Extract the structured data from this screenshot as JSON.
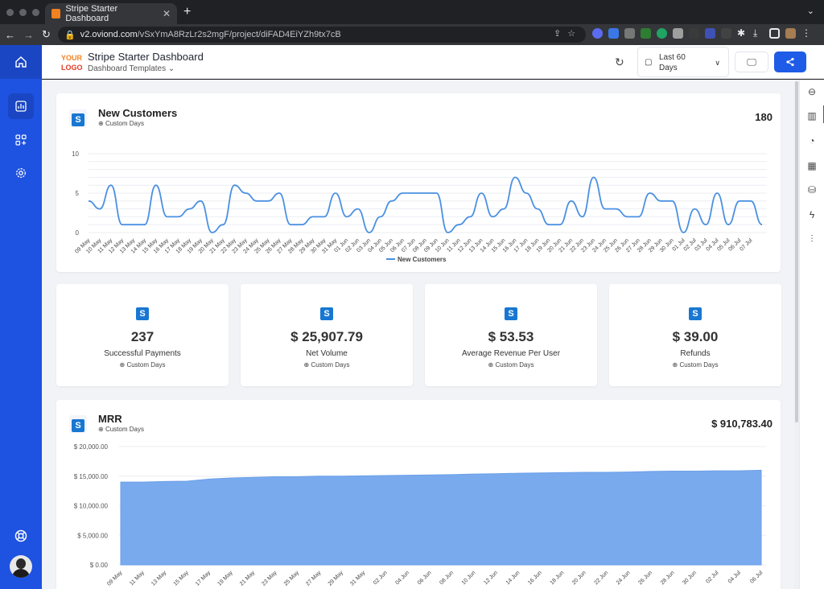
{
  "browser": {
    "tab_title": "Stripe Starter Dashboard",
    "url_host": "v2.oviond.com",
    "url_path": "/vSxYmA8RzLr2s2mgF/project/diFAD4EiYZh9tx7cB"
  },
  "header": {
    "logo_line1": "YOUR",
    "logo_line2": "LOGO",
    "title": "Stripe Starter Dashboard",
    "subtitle": "Dashboard Templates",
    "date_range": "Last 60 Days"
  },
  "colors": {
    "accent": "#1e5be6",
    "sidebar": "#1e52e0",
    "line": "#4a90e2",
    "area": "#79aaee"
  },
  "cards": {
    "new_customers": {
      "title": "New Customers",
      "sub": "Custom Days",
      "value": "180",
      "legend": "New Customers"
    },
    "mrr": {
      "title": "MRR",
      "sub": "Custom Days",
      "value": "$ 910,783.40"
    }
  },
  "stats": [
    {
      "value": "237",
      "label": "Successful Payments",
      "sub": "Custom Days"
    },
    {
      "value": "$ 25,907.79",
      "label": "Net Volume",
      "sub": "Custom Days"
    },
    {
      "value": "$ 53.53",
      "label": "Average Revenue Per User",
      "sub": "Custom Days"
    },
    {
      "value": "$ 39.00",
      "label": "Refunds",
      "sub": "Custom Days"
    }
  ],
  "chart_data": [
    {
      "type": "line",
      "title": "New Customers",
      "x": [
        "09 May",
        "10 May",
        "11 May",
        "12 May",
        "13 May",
        "14 May",
        "15 May",
        "16 May",
        "17 May",
        "18 May",
        "19 May",
        "20 May",
        "21 May",
        "22 May",
        "23 May",
        "24 May",
        "25 May",
        "26 May",
        "27 May",
        "28 May",
        "29 May",
        "30 May",
        "31 May",
        "01 Jun",
        "02 Jun",
        "03 Jun",
        "04 Jun",
        "05 Jun",
        "06 Jun",
        "07 Jun",
        "08 Jun",
        "09 Jun",
        "10 Jun",
        "11 Jun",
        "12 Jun",
        "13 Jun",
        "14 Jun",
        "15 Jun",
        "16 Jun",
        "17 Jun",
        "18 Jun",
        "19 Jun",
        "20 Jun",
        "21 Jun",
        "22 Jun",
        "23 Jun",
        "24 Jun",
        "25 Jun",
        "26 Jun",
        "27 Jun",
        "28 Jun",
        "29 Jun",
        "30 Jun",
        "01 Jul",
        "02 Jul",
        "03 Jul",
        "04 Jul",
        "05 Jul",
        "06 Jul",
        "07 Jul"
      ],
      "series": [
        {
          "name": "New Customers",
          "values": [
            4,
            3,
            6,
            1,
            1,
            1,
            6,
            2,
            2,
            3,
            4,
            0,
            1,
            6,
            5,
            4,
            4,
            5,
            1,
            1,
            2,
            2,
            5,
            2,
            3,
            0,
            2,
            4,
            5,
            5,
            5,
            5,
            0,
            1,
            2,
            5,
            2,
            3,
            7,
            5,
            3,
            1,
            1,
            4,
            2,
            7,
            3,
            3,
            2,
            2,
            5,
            4,
            4,
            0,
            3,
            1,
            5,
            1,
            4,
            4,
            1
          ]
        }
      ],
      "ylim": [
        0,
        10
      ],
      "yticks": [
        "0",
        "5",
        "10"
      ],
      "legend": "bottom"
    },
    {
      "type": "area",
      "title": "MRR",
      "x": [
        "09 May",
        "11 May",
        "13 May",
        "15 May",
        "17 May",
        "19 May",
        "21 May",
        "23 May",
        "25 May",
        "27 May",
        "29 May",
        "31 May",
        "02 Jun",
        "04 Jun",
        "06 Jun",
        "08 Jun",
        "10 Jun",
        "12 Jun",
        "14 Jun",
        "16 Jun",
        "18 Jun",
        "20 Jun",
        "22 Jun",
        "24 Jun",
        "26 Jun",
        "28 Jun",
        "30 Jun",
        "02 Jul",
        "04 Jul",
        "06 Jul"
      ],
      "series": [
        {
          "name": "MRR",
          "values": [
            14000,
            14000,
            14100,
            14150,
            14500,
            14700,
            14800,
            14900,
            14900,
            15000,
            15000,
            15050,
            15100,
            15150,
            15200,
            15250,
            15350,
            15400,
            15500,
            15550,
            15600,
            15650,
            15650,
            15700,
            15800,
            15850,
            15850,
            15900,
            15900,
            16000
          ]
        }
      ],
      "ylim": [
        0,
        20000
      ],
      "yticks": [
        "$ 0.00",
        "$ 5,000.00",
        "$ 10,000.00",
        "$ 15,000.00",
        "$ 20,000.00"
      ]
    }
  ]
}
